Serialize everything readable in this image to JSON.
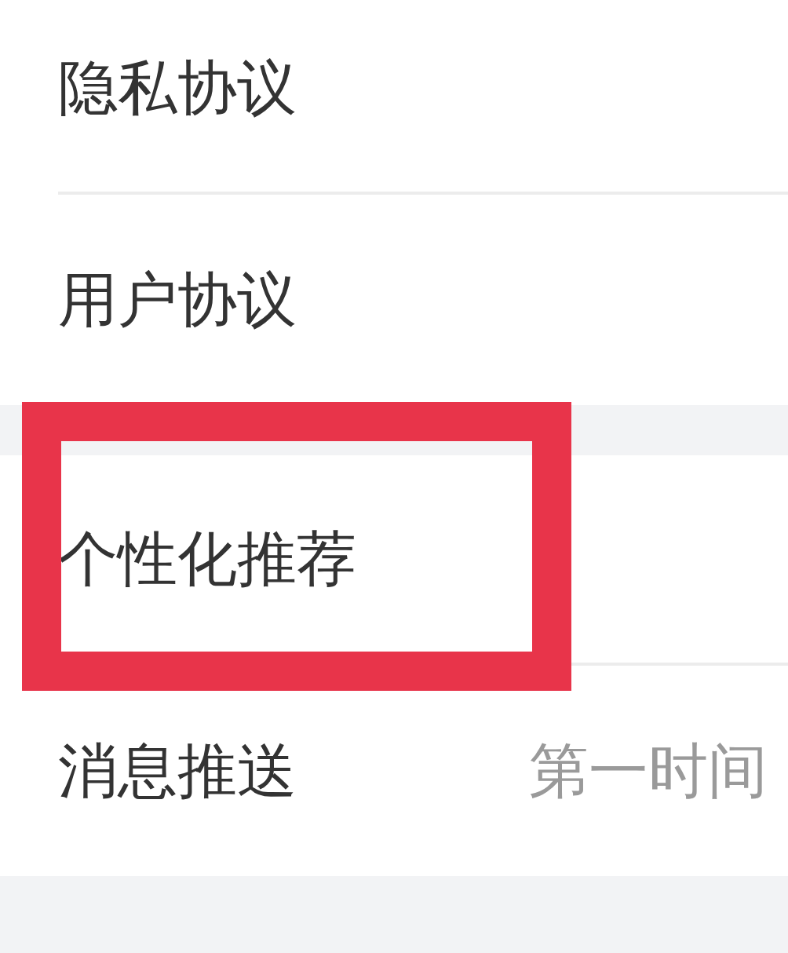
{
  "sections": [
    {
      "items": [
        {
          "label": "隐私协议",
          "highlighted": false
        },
        {
          "label": "用户协议",
          "highlighted": false
        }
      ]
    },
    {
      "items": [
        {
          "label": "个性化推荐",
          "highlighted": true
        },
        {
          "label": "消息推送",
          "value": "第一时间",
          "highlighted": false
        }
      ]
    }
  ]
}
